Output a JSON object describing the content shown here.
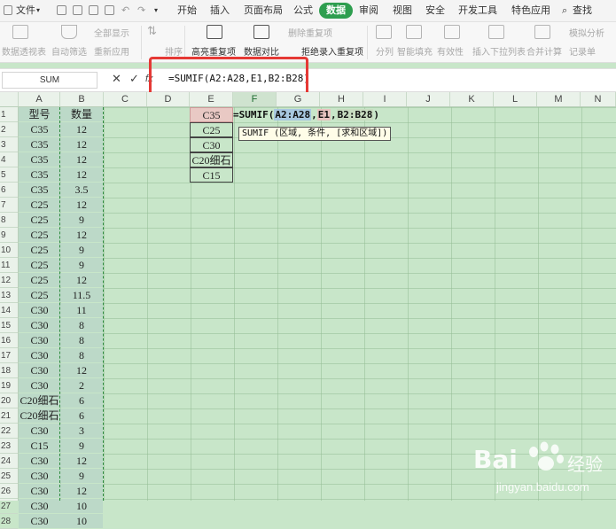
{
  "menu": {
    "file_label": "文件",
    "tabs": [
      "开始",
      "插入",
      "页面布局",
      "公式",
      "数据",
      "审阅",
      "视图",
      "安全",
      "开发工具",
      "特色应用"
    ],
    "active_tab": "数据",
    "search_label": "查找"
  },
  "ribbon": {
    "pivot_label": "数据透视表",
    "autofilter_label": "自动筛选",
    "show_all_label": "全部显示",
    "reapply_label": "重新应用",
    "sort_label": "排序",
    "highlight_dup_label": "高亮重复项",
    "compare_label": "数据对比",
    "remove_dup_label": "删除重复项",
    "reject_dup_label": "拒绝录入重复项",
    "split_label": "分列",
    "smart_fill_label": "智能填充",
    "validity_label": "有效性",
    "dropdown_label": "插入下拉列表",
    "consolidate_label": "合并计算",
    "simulate_label": "模拟分析",
    "record_label": "记录单"
  },
  "formula_bar": {
    "name_box": "SUM",
    "cancel": "✕",
    "confirm": "✓",
    "fx": "fx",
    "formula": "=SUMIF(A2:A28,E1,B2:B28)"
  },
  "columns": [
    "A",
    "B",
    "C",
    "D",
    "E",
    "F",
    "G",
    "H",
    "I",
    "J",
    "K",
    "L",
    "M",
    "N"
  ],
  "rows": [
    "1",
    "2",
    "3",
    "4",
    "5",
    "6",
    "7",
    "8",
    "9",
    "10",
    "11",
    "12",
    "13",
    "14",
    "15",
    "16",
    "17",
    "18",
    "19",
    "20",
    "21",
    "22",
    "23",
    "24",
    "25",
    "26",
    "27",
    "28"
  ],
  "table": {
    "headers": {
      "a": "型号",
      "b": "数量"
    },
    "rows": [
      {
        "a": "C35",
        "b": "12"
      },
      {
        "a": "C35",
        "b": "12"
      },
      {
        "a": "C35",
        "b": "12"
      },
      {
        "a": "C35",
        "b": "12"
      },
      {
        "a": "C35",
        "b": "3.5"
      },
      {
        "a": "C25",
        "b": "12"
      },
      {
        "a": "C25",
        "b": "9"
      },
      {
        "a": "C25",
        "b": "12"
      },
      {
        "a": "C25",
        "b": "9"
      },
      {
        "a": "C25",
        "b": "9"
      },
      {
        "a": "C25",
        "b": "12"
      },
      {
        "a": "C25",
        "b": "11.5"
      },
      {
        "a": "C30",
        "b": "11"
      },
      {
        "a": "C30",
        "b": "8"
      },
      {
        "a": "C30",
        "b": "8"
      },
      {
        "a": "C30",
        "b": "8"
      },
      {
        "a": "C30",
        "b": "12"
      },
      {
        "a": "C30",
        "b": "2"
      },
      {
        "a": "C20细石",
        "b": "6"
      },
      {
        "a": "C20细石",
        "b": "6"
      },
      {
        "a": "C30",
        "b": "3"
      },
      {
        "a": "C15",
        "b": "9"
      },
      {
        "a": "C30",
        "b": "12"
      },
      {
        "a": "C30",
        "b": "9"
      },
      {
        "a": "C30",
        "b": "12"
      },
      {
        "a": "C30",
        "b": "10"
      },
      {
        "a": "C30",
        "b": "10"
      }
    ]
  },
  "criteria_list": [
    "C35",
    "C25",
    "C30",
    "C20细石",
    "C15"
  ],
  "edit_cell": {
    "prefix": "=SUMIF(",
    "ref1": "A2:A28",
    "comma1": ",",
    "ref2": "E1",
    "comma2": ",",
    "ref3": "B2:B28",
    "suffix": ")"
  },
  "tooltip": "SUMIF (区域, 条件, [求和区域])",
  "watermark": {
    "brand": "Bai",
    "brand_suffix": "经验",
    "url": "jingyan.baidu.com"
  },
  "colors": {
    "accent": "#2e9e4f",
    "highlight_box": "#e53935",
    "sheet_bg": "#c8e6c9"
  }
}
